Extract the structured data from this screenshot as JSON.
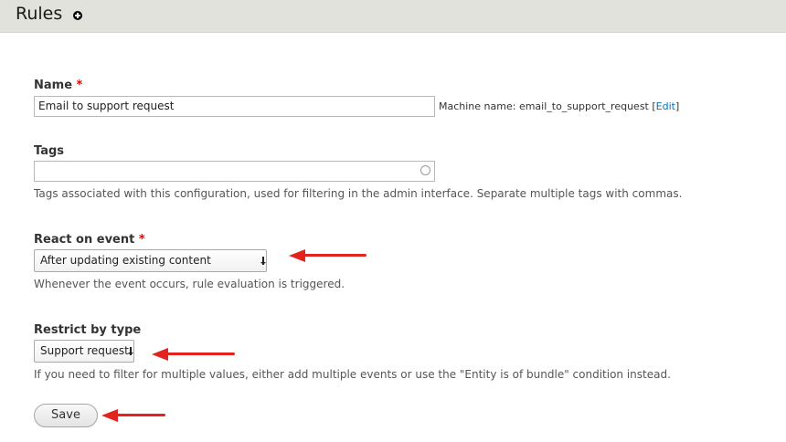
{
  "header": {
    "title": "Rules",
    "shortcut_icon": "add-shortcut-icon"
  },
  "form": {
    "name": {
      "label": "Name",
      "required_marker": "*",
      "value": "Email to support request",
      "machine_name_prefix": "Machine name: email_to_support_request [",
      "machine_name_edit": "Edit",
      "machine_name_suffix": "]"
    },
    "tags": {
      "label": "Tags",
      "value": "",
      "description": "Tags associated with this configuration, used for filtering in the admin interface. Separate multiple tags with commas."
    },
    "event": {
      "label": "React on event",
      "required_marker": "*",
      "selected": "After updating existing content",
      "description": "Whenever the event occurs, rule evaluation is triggered."
    },
    "restrict": {
      "label": "Restrict by type",
      "selected": "Support request",
      "description": "If you need to filter for multiple values, either add multiple events or use the \"Entity is of bundle\" condition instead."
    },
    "save_label": "Save"
  },
  "annotations": {
    "arrow_color": "#e3231f"
  }
}
